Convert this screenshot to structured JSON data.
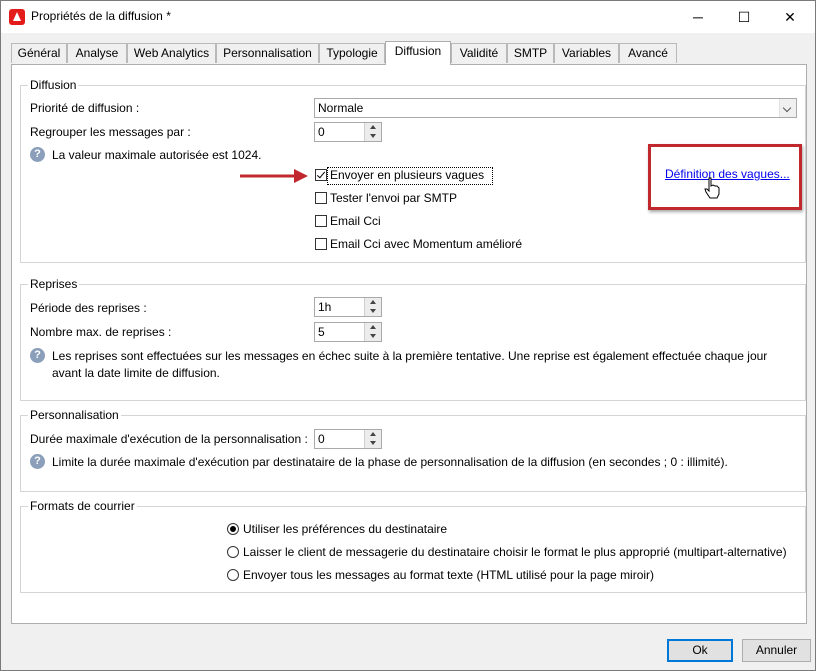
{
  "window": {
    "title": "Propriétés de la diffusion *",
    "controls": {
      "minimize": "─",
      "maximize": "☐",
      "close": "✕"
    }
  },
  "tabs": [
    {
      "label": "Général"
    },
    {
      "label": "Analyse"
    },
    {
      "label": "Web Analytics"
    },
    {
      "label": "Personnalisation"
    },
    {
      "label": "Typologie"
    },
    {
      "label": "Diffusion",
      "active": true
    },
    {
      "label": "Validité"
    },
    {
      "label": "SMTP"
    },
    {
      "label": "Variables"
    },
    {
      "label": "Avancé"
    }
  ],
  "diffusion": {
    "title": "Diffusion",
    "priority_label": "Priorité de diffusion :",
    "priority_value": "Normale",
    "group_label": "Regrouper les messages par :",
    "group_value": "0",
    "help_text": "La valeur maximale autorisée est 1024.",
    "checkboxes": [
      {
        "label": "Envoyer en plusieurs vagues",
        "checked": true
      },
      {
        "label": "Tester l'envoi par SMTP",
        "checked": false
      },
      {
        "label": "Email Cci",
        "checked": false
      },
      {
        "label": "Email Cci avec Momentum amélioré",
        "checked": false
      }
    ],
    "waves_link": "Définition des vagues..."
  },
  "reprises": {
    "title": "Reprises",
    "period_label": "Période des reprises :",
    "period_value": "1h",
    "max_label": "Nombre max. de reprises :",
    "max_value": "5",
    "help_line1": "Les reprises sont effectuées sur les messages en échec suite à la première tentative. Une reprise est également effectuée chaque jour",
    "help_line2": "avant la date limite de diffusion."
  },
  "personnalisation": {
    "title": "Personnalisation",
    "duration_label": "Durée maximale d'exécution de la personnalisation :",
    "duration_value": "0",
    "help_text": "Limite la durée maximale d'exécution par destinataire de la phase de personnalisation de la diffusion (en secondes ; 0 : illimité)."
  },
  "formats": {
    "title": "Formats de courrier",
    "options": [
      {
        "label": "Utiliser les préférences du destinataire",
        "selected": true
      },
      {
        "label": "Laisser le client de messagerie du destinataire choisir le format le plus approprié (multipart-alternative)",
        "selected": false
      },
      {
        "label": "Envoyer tous les messages au format texte (HTML utilisé pour la page miroir)",
        "selected": false
      }
    ]
  },
  "footer": {
    "ok": "Ok",
    "cancel": "Annuler"
  },
  "colors": {
    "annotation_red": "#c0282d",
    "link_blue": "#0000ee",
    "default_button_border": "#0078d7"
  },
  "icons": {
    "help": "question-circle-icon",
    "pointer": "hand-cursor-icon",
    "annotation": "red-arrow-icon"
  }
}
